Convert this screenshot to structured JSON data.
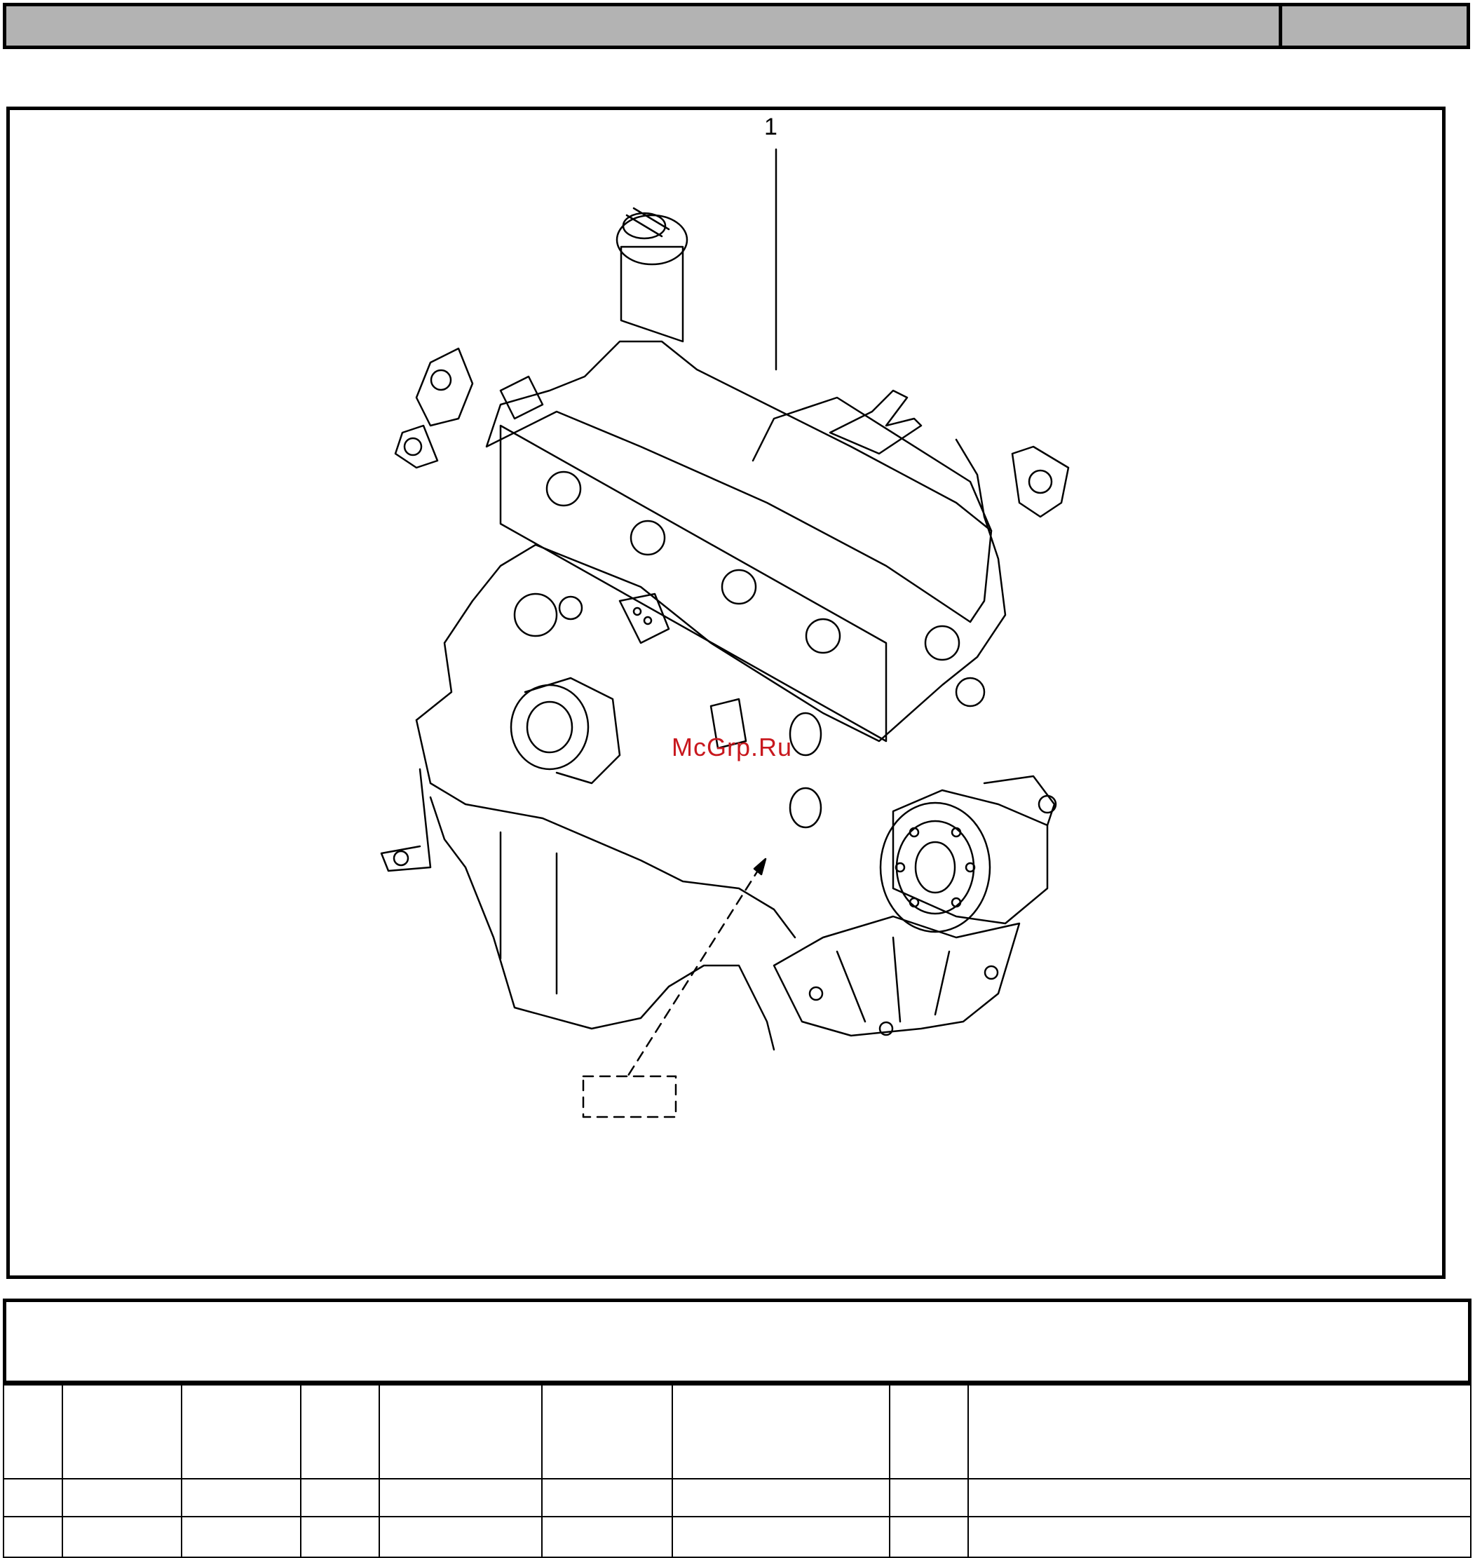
{
  "header": {
    "title": "",
    "page": ""
  },
  "illustration": {
    "callout": "1",
    "watermark": "McGrp.Ru"
  },
  "caption": "",
  "parts_table": {
    "headers": [
      "",
      "",
      "",
      "",
      "",
      "",
      "",
      "",
      ""
    ],
    "rows": [
      [
        "",
        "",
        "",
        "",
        "",
        "",
        "",
        "",
        ""
      ],
      [
        "",
        "",
        "",
        "",
        "",
        "",
        "",
        "",
        ""
      ]
    ]
  }
}
